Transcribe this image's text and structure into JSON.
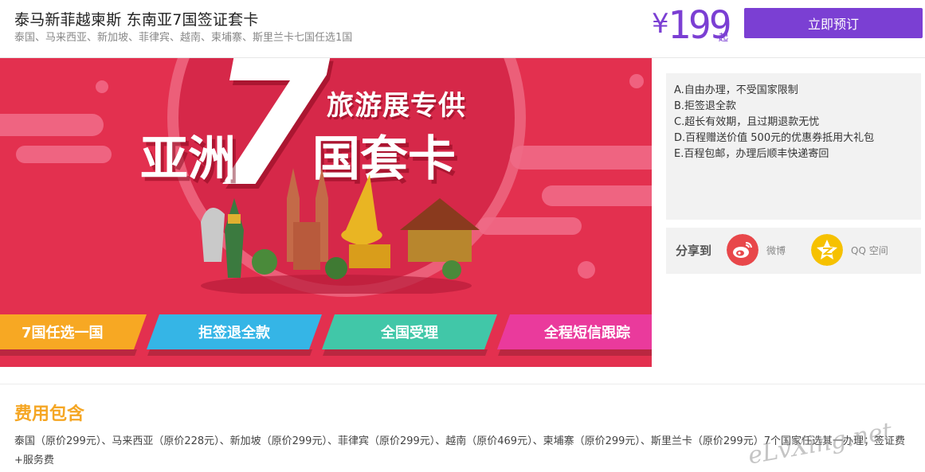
{
  "header": {
    "title": "泰马新菲越柬斯 东南亚7国签证套卡",
    "subtitle": "泰国、马来西亚、新加坡、菲律宾、越南、柬埔寨、斯里兰卡七国任选1国",
    "price_symbol": "¥",
    "price_value": "199",
    "price_unit": "起",
    "book_button": "立即预订"
  },
  "banner": {
    "line1": "旅游展专供",
    "seven": "7",
    "line2a": "亚洲",
    "line2b": "国套卡",
    "ribbons": [
      {
        "label": "7国任选一国",
        "color": "#f7a823"
      },
      {
        "label": "拒签退全款",
        "color": "#35b5e6"
      },
      {
        "label": "全国受理",
        "color": "#41c7a8"
      },
      {
        "label": "全程短信跟踪",
        "color": "#ea3a9c"
      }
    ]
  },
  "features": [
    "A.自由办理，不受国家限制",
    "B.拒签退全款",
    "C.超长有效期，且过期退款无忧",
    "D.百程赠送价值 500元的优惠券抵用大礼包",
    "E.百程包邮，办理后顺丰快递寄回"
  ],
  "share": {
    "label": "分享到",
    "weibo": "微博",
    "qq": "QQ 空间"
  },
  "fee": {
    "title": "费用包含",
    "text": "泰国（原价299元）、马来西亚（原价228元）、新加坡（原价299元）、菲律宾（原价299元）、越南（原价469元）、柬埔寨（原价299元）、斯里兰卡（原价299元）7个国家任选其一办理；签证费+服务费"
  },
  "watermark": "eLvXing.net",
  "colors": {
    "accent": "#7b3fd3",
    "banner_red": "#e3304f",
    "fee_title": "#f5a623",
    "weibo": "#e8474a",
    "qq": "#f6c100"
  }
}
